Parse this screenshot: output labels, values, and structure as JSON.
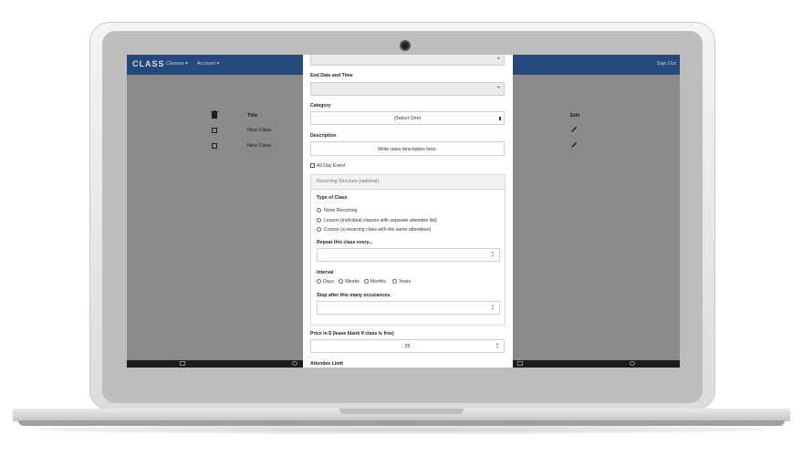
{
  "navbar": {
    "brand": "CLASS",
    "links": [
      "Classes ▾",
      "Account ▾"
    ],
    "signout": "Sign Out"
  },
  "table": {
    "headers": {
      "title": "Title",
      "edit": "Edit"
    },
    "rows": [
      {
        "title": "New Class"
      },
      {
        "title": "New Class"
      }
    ]
  },
  "modal": {
    "end_date_label": "End Date and Time",
    "category_label": "Category",
    "category_value": "(Select One)",
    "description_label": "Description",
    "description_placeholder": "Write class description here.",
    "all_day_label": "All Day Event",
    "recurring": {
      "title": "Recurring Structure (optional)",
      "type_label": "Type of Class",
      "types": [
        "None Recurring",
        "Lesson (individual classes with separate attendee list)",
        "Course (a recurring class with the same attendees)"
      ],
      "repeat_label": "Repeat this class every...",
      "interval_label": "Interval",
      "intervals": [
        "Days",
        "Weeks",
        "Months",
        "Years"
      ],
      "stop_label": "Stop after this many occurances."
    },
    "price_label": "Price in $ (leave blank if class is free)",
    "price_value": "25",
    "attendee_label": "Attendee Limit"
  },
  "colors": {
    "navbar": "#26497c",
    "overlay": "#8a8a8a",
    "modal_bg": "#ffffff"
  },
  "icons": [
    "trash-icon",
    "checkbox-icon",
    "pencil-icon",
    "plus-icon",
    "spinner-icon",
    "calendar-icon",
    "gear-icon"
  ]
}
